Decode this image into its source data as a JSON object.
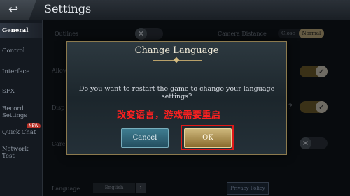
{
  "header": {
    "title": "Settings",
    "back_icon": "back-arrow-icon"
  },
  "sidebar": {
    "items": [
      {
        "label": "General",
        "active": true
      },
      {
        "label": "Control"
      },
      {
        "label": "Interface"
      },
      {
        "label": "SFX"
      },
      {
        "label": "Record Settings"
      },
      {
        "label": "Quick Chat"
      },
      {
        "label": "Network Test"
      }
    ],
    "new_badge": "NEW"
  },
  "settings": {
    "outlines_label": "Outlines",
    "camera_distance_label": "Camera Distance",
    "camera_options": [
      "Close",
      "Normal"
    ],
    "camera_selected": "Normal",
    "label_allow": "Allow",
    "label_disp": "Disp",
    "label_care": "Care",
    "help_mark": "?",
    "language_label": "Language",
    "language_value": "English",
    "privacy_policy": "Privacy Policy"
  },
  "dialog": {
    "title": "Change Language",
    "message": "Do you want to restart the game to change your language settings?",
    "annotation_cn": "改变语言，游戏需要重启",
    "cancel_label": "Cancel",
    "ok_label": "OK"
  },
  "colors": {
    "accent_gold": "#c9ad6a",
    "annotation_red": "#ff2020",
    "cancel_blue": "#356a7c"
  }
}
